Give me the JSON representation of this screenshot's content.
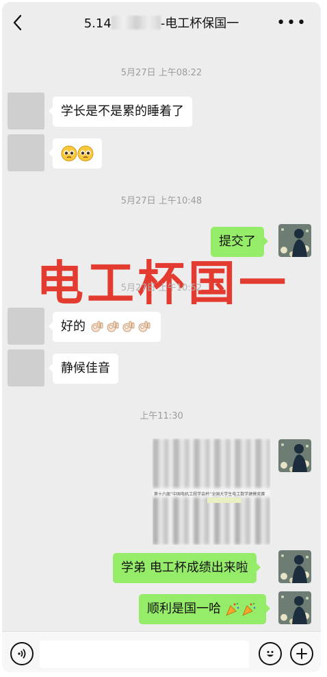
{
  "header": {
    "title_prefix": "5.14",
    "title_suffix": "-电工杯保国一",
    "more_label": "•••"
  },
  "messages": {
    "time1": "5月27日 上午08:22",
    "m1": "学长是不是累的睡着了",
    "time2": "5月27日 上午10:48",
    "m3": "提交了",
    "time3": "5月27日 上午10:52",
    "m4": "好的",
    "m5": "静候佳音",
    "time4": "上午11:30",
    "image_caption": "第十六届“中国电机工程学会杯”全国大学生电工数学建模竞赛",
    "m6": "学弟 电工杯成绩出来啦",
    "m7": "顺利是国一哈"
  },
  "watermark": "电工杯国一",
  "icons": {
    "back": "chevron-left-icon",
    "more": "more-icon",
    "voice": "voice-icon",
    "emoji": "emoji-icon",
    "plus": "plus-icon"
  },
  "colors": {
    "chat_bg": "#ededed",
    "self_bubble": "#95ec69",
    "other_bubble": "#ffffff",
    "watermark": "#e33b2f"
  }
}
